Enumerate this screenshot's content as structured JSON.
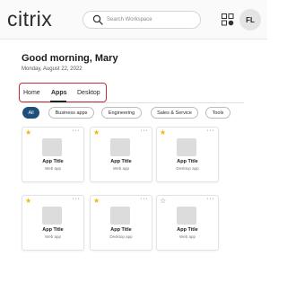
{
  "header": {
    "logo": "citrix",
    "search_placeholder": "Search Workspace",
    "avatar_initials": "FL"
  },
  "greeting": "Good morning, Mary",
  "date": "Monday, August 22, 2022",
  "tabs": [
    {
      "label": "Home",
      "active": false
    },
    {
      "label": "Apps",
      "active": true
    },
    {
      "label": "Desktop",
      "active": false
    }
  ],
  "filters": [
    {
      "label": "All",
      "active": true
    },
    {
      "label": "Business apps",
      "active": false
    },
    {
      "label": "Engineering",
      "active": false
    },
    {
      "label": "Sales & Service",
      "active": false
    },
    {
      "label": "Tools",
      "active": false
    }
  ],
  "apps": [
    {
      "title": "App Title",
      "subtitle": "Web app",
      "favorite": true
    },
    {
      "title": "App Title",
      "subtitle": "Web app",
      "favorite": true
    },
    {
      "title": "App Title",
      "subtitle": "Desktop app",
      "favorite": true
    },
    {
      "title": "App Title",
      "subtitle": "Web app",
      "favorite": true
    },
    {
      "title": "App Title",
      "subtitle": "Desktop app",
      "favorite": true
    },
    {
      "title": "App Title",
      "subtitle": "Web app",
      "favorite": false
    }
  ],
  "icons": {
    "search": "search-icon",
    "apps_grid": "apps-grid-icon",
    "favorite": "star-icon",
    "more": "more-icon"
  },
  "colors": {
    "accent": "#1e4f7a",
    "favorite": "#f2b705",
    "highlight_box": "#c0303c"
  }
}
